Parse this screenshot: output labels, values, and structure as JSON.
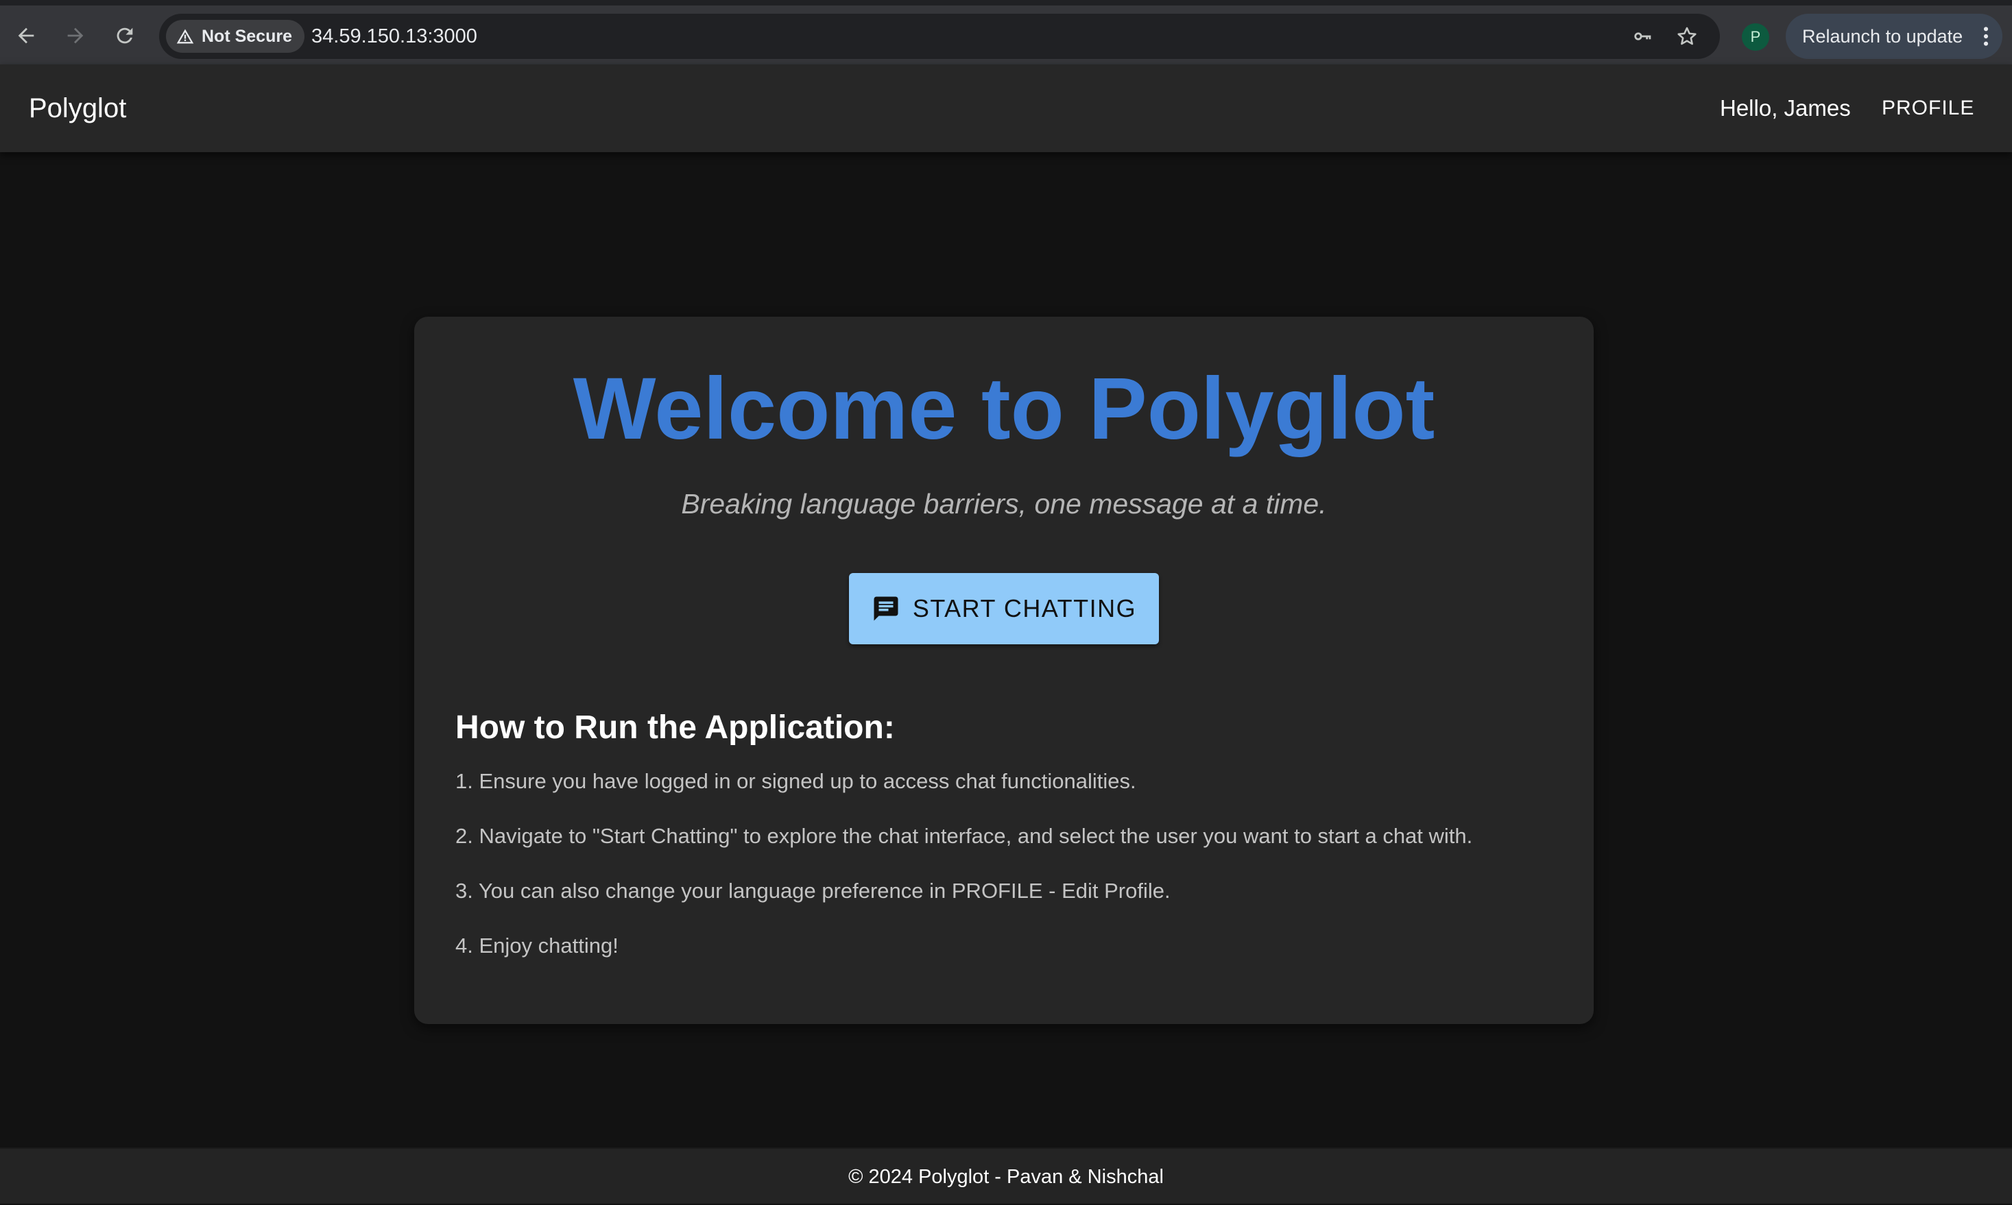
{
  "browser": {
    "security_label": "Not Secure",
    "url": "34.59.150.13:3000",
    "profile_initial": "P",
    "relaunch_label": "Relaunch to update"
  },
  "header": {
    "brand": "Polyglot",
    "greeting": "Hello, James",
    "profile_label": "PROFILE"
  },
  "main": {
    "title": "Welcome to Polyglot",
    "tagline": "Breaking language barriers, one message at a time.",
    "start_button_label": "START CHATTING",
    "howto_heading": "How to Run the Application:",
    "steps": [
      "1. Ensure you have logged in or signed up to access chat functionalities.",
      "2. Navigate to \"Start Chatting\" to explore the chat interface, and select the user you want to start a chat with.",
      "3. You can also change your language preference in PROFILE - Edit Profile.",
      "4. Enjoy chatting!"
    ]
  },
  "footer": {
    "text": "© 2024 Polyglot - Pavan & Nishchal"
  },
  "colors": {
    "accent_title": "#3b7bd4",
    "button_bg": "#90caf9",
    "page_bg": "#121212",
    "card_bg": "#262626"
  },
  "icons": {
    "back": "arrow-left-icon",
    "forward": "arrow-right-icon",
    "reload": "reload-icon",
    "warning": "warning-triangle-icon",
    "password": "key-icon",
    "bookmark": "star-icon",
    "menu": "kebab-menu-icon",
    "chat": "chat-bubble-icon"
  }
}
